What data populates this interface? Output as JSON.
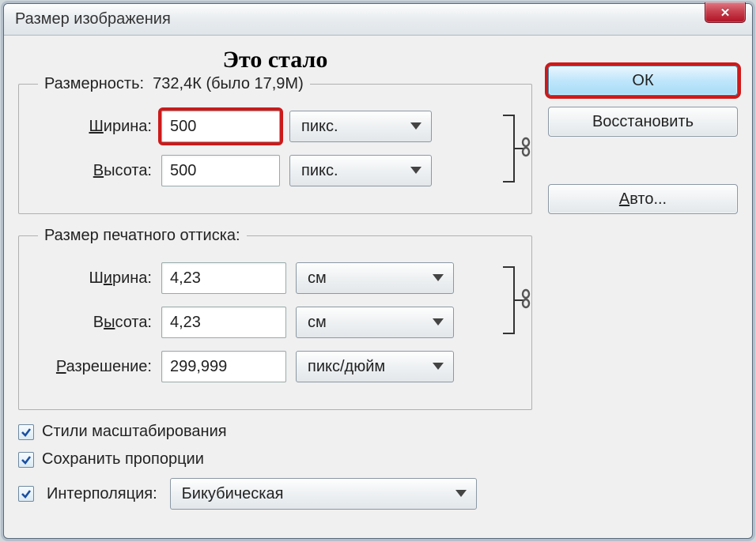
{
  "window": {
    "title": "Размер изображения"
  },
  "annotation": "Это стало",
  "pixel_dims": {
    "legend_prefix": "Размерность:",
    "size_current": "732,4К",
    "size_was": "(было 17,9М)",
    "width_label": "Ширина:",
    "width_value": "500",
    "width_unit": "пикс.",
    "height_label": "Высота:",
    "height_value": "500",
    "height_unit": "пикс."
  },
  "print_dims": {
    "legend": "Размер печатного оттиска:",
    "width_label": "Ширина:",
    "width_value": "4,23",
    "width_unit": "см",
    "height_label": "Высота:",
    "height_value": "4,23",
    "height_unit": "см",
    "resolution_label": "Разрешение:",
    "resolution_value": "299,999",
    "resolution_unit": "пикс/дюйм"
  },
  "checkboxes": {
    "scale_styles": "Стили масштабирования",
    "constrain": "Сохранить пропорции",
    "interp_label": "Интерполяция:",
    "interp_value": "Бикубическая"
  },
  "buttons": {
    "ok": "ОК",
    "reset": "Восстановить",
    "auto": "Авто..."
  }
}
